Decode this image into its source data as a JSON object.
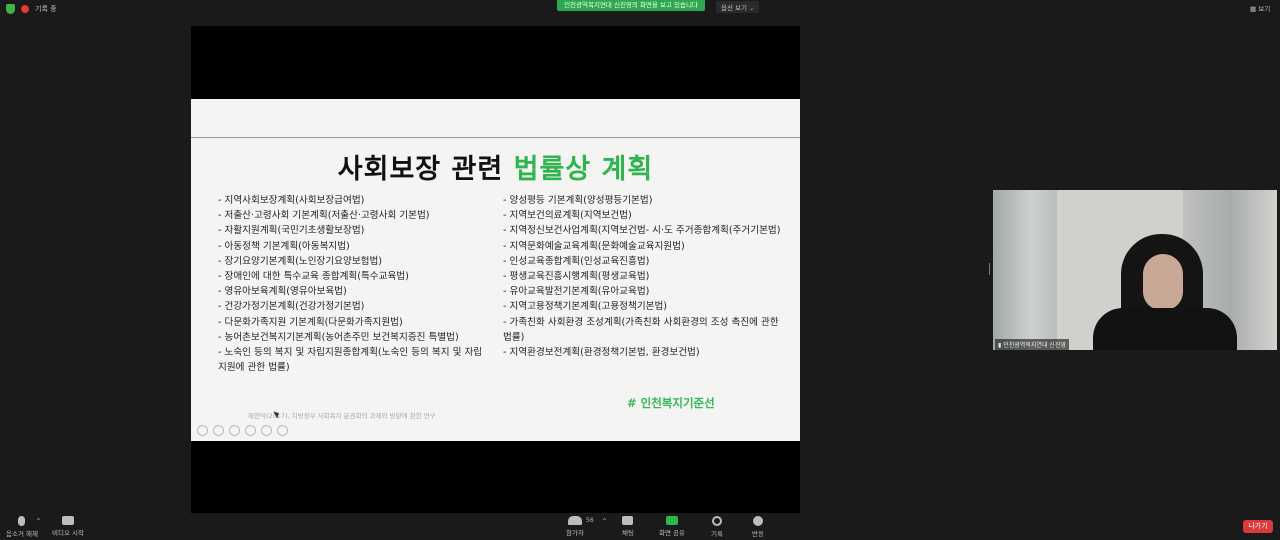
{
  "top_bar": {
    "recording_label": "기록 중",
    "banner_text": "인천광역복지연대 신진영의 화면을 보고 있습니다",
    "view_options_label": "옵션 보기",
    "view_label": "보기"
  },
  "slide": {
    "title_plain": "사회보장 관련 ",
    "title_highlight": "법률상 계획",
    "left_items": [
      "- 지역사회보장계획(사회보장급여법)",
      "- 저출산·고령사회 기본계획(저출산·고령사회 기본법)",
      "- 자활지원계획(국민기초생활보장법)",
      "- 아동정책 기본계획(아동복지법)",
      "- 장기요양기본계획(노인장기요양보험법)",
      "- 장애인에 대한 특수교육 종합계획(특수교육법)",
      "- 영유아보육계획(영유아보육법)",
      "- 건강가정기본계획(건강가정기본법)",
      "- 다문화가족지원 기본계획(다문화가족지원법)",
      "- 농어촌보건복지기본계획(농어촌주민 보건복지증진 특별법)",
      "- 노숙인 등의 복지 및 자립지원종합계획(노숙인 등의 복지 및 자립지원에 관한 법률)"
    ],
    "right_items": [
      "- 양성평등 기본계획(양성평등기본법)",
      "- 지역보건의료계획(지역보건법)",
      "- 지역정신보건사업계획(지역보건법- 시·도 주거종합계획(주거기본법)",
      "- 지역문화예술교육계획(문화예술교육지원법)",
      "- 인성교육종합계획(인성교육진흥법)",
      "- 평생교육진흥시행계획(평생교육법)",
      "- 유아교육발전기본계획(유아교육법)",
      "- 지역고용정책기본계획(고용정책기본법)",
      "- 가족친화 사회환경 조성계획(가족친화 사회환경의 조성 촉진에 관한 법률)",
      "- 지역환경보전계획(환경정책기본법, 환경보건법)"
    ],
    "hashtag": "# 인천복지기준선",
    "citation": "제현덕(2017), 지방정부 사회복지 분권화의 과제와 방향에 관한 연구"
  },
  "video": {
    "name_label": "인천광역복지연대 신진영"
  },
  "toolbar": {
    "mute_label": "음소거 해제",
    "video_label": "비디오 시작",
    "participants_label": "참가자",
    "participants_count": "56",
    "chat_label": "채팅",
    "share_label": "화면 공유",
    "record_label": "기록",
    "reactions_label": "반응",
    "leave_label": "나가기"
  }
}
